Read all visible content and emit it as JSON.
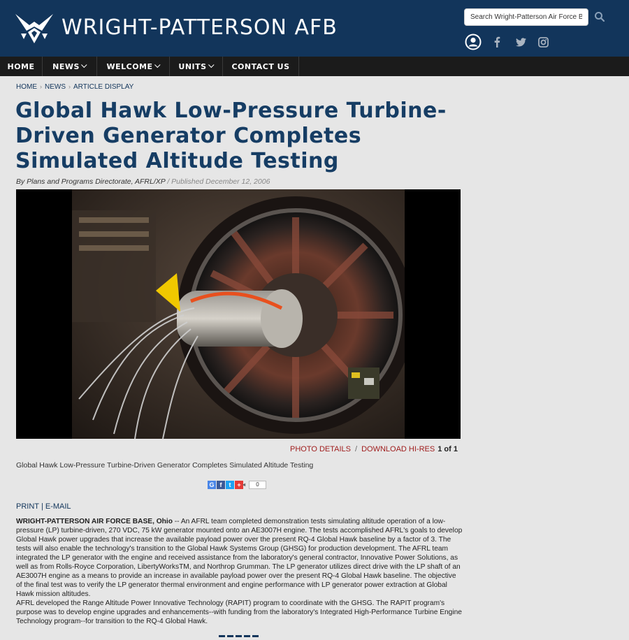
{
  "site": {
    "title": "WRIGHT-PATTERSON AFB",
    "search_placeholder": "Search Wright-Patterson Air Force Base"
  },
  "header_icons": [
    "user-icon",
    "facebook-icon",
    "twitter-icon",
    "instagram-icon"
  ],
  "nav": {
    "items": [
      {
        "label": "HOME"
      },
      {
        "label": "NEWS"
      },
      {
        "label": "WELCOME"
      },
      {
        "label": "UNITS"
      },
      {
        "label": "CONTACT US"
      }
    ]
  },
  "breadcrumb": [
    "HOME",
    "NEWS",
    "ARTICLE DISPLAY"
  ],
  "article": {
    "title": "Global Hawk Low-Pressure Turbine-Driven Generator Completes Simulated Altitude Testing",
    "byline": "By Plans and Programs Directorate, AFRL/XP",
    "published": "/ Published December 12, 2006",
    "photo_details": "PHOTO DETAILS",
    "photo_sep": "/",
    "download": "DOWNLOAD HI-RES",
    "photo_count": "1 of 1",
    "caption": "Global Hawk Low-Pressure Turbine-Driven Generator Completes Simulated Altitude Testing",
    "share_count": "0",
    "print": "PRINT",
    "print_sep": "|",
    "email": "E-MAIL",
    "dateline": "WRIGHT-PATTERSON AIR FORCE BASE, Ohio",
    "para1": " -- An AFRL team completed demonstration tests simulating altitude operation of a low-pressure (LP) turbine-driven, 270 VDC, 75 kW generator mounted onto an AE3007H engine. The tests accomplished AFRL's goals to develop Global Hawk power upgrades that increase the available payload power over the present RQ-4 Global Hawk baseline by a factor of 3. The tests will also enable the technology's transition to the Global Hawk Systems Group (GHSG) for production development. The AFRL team integrated the LP generator with the engine and received assistance from the laboratory's general contractor, Innovative Power Solutions, as well as from Rolls-Royce Corporation, LibertyWorksTM, and Northrop Grumman. The LP generator utilizes direct drive with the LP shaft of an AE3007H engine as a means to provide an increase in available payload power over the present RQ-4 Global Hawk baseline. The objective of the final test was to verify the LP generator thermal environment and engine performance with LP generator power extraction at Global Hawk mission altitudes.",
    "para2": "AFRL developed the Range Altitude Power Innovative Technology (RAPIT) program to coordinate with the GHSG. The RAPIT program's purpose was to develop engine upgrades and enhancements--with funding from the laboratory's Integrated High-Performance Turbine Engine Technology program--for transition to the RQ-4 Global Hawk."
  },
  "colors": {
    "header_bg": "#12355b",
    "nav_bg": "#1b1b1b",
    "title": "#163d64",
    "link_red": "#a01e1e",
    "page_bg": "#e6e6e6"
  }
}
